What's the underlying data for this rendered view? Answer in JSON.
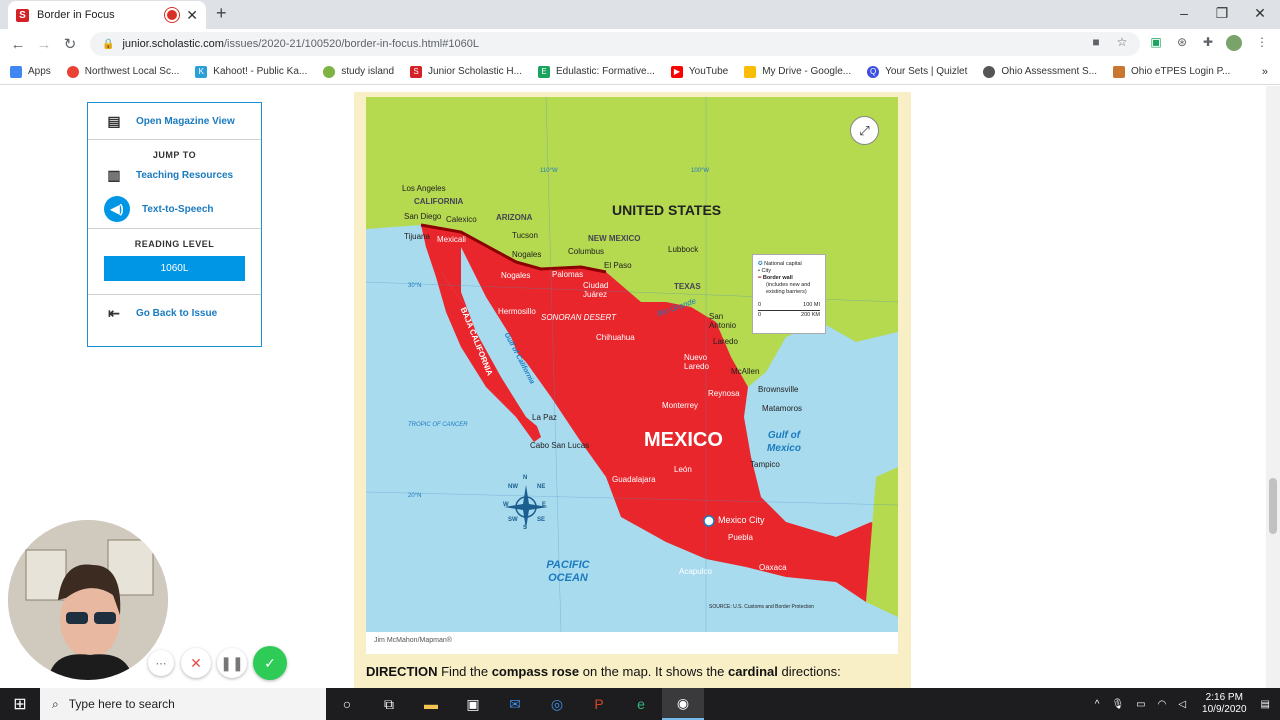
{
  "browser": {
    "tab_title": "Border in Focus",
    "favicon_letter": "S",
    "new_tab": "+",
    "url_host": "junior.scholastic.com",
    "url_path": "/issues/2020-21/100520/border-in-focus.html#1060L"
  },
  "bookmarks": [
    {
      "label": "Apps",
      "color": "#4285f4"
    },
    {
      "label": "Northwest Local Sc...",
      "color": "#e94235"
    },
    {
      "label": "Kahoot! - Public Ka...",
      "color": "#2a9fd8"
    },
    {
      "label": "study island",
      "color": "#7cb342"
    },
    {
      "label": "Junior Scholastic H...",
      "color": "#d42127"
    },
    {
      "label": "Edulastic: Formative...",
      "color": "#1aa260"
    },
    {
      "label": "YouTube",
      "color": "#ff0000"
    },
    {
      "label": "My Drive - Google...",
      "color": "#fbbc04"
    },
    {
      "label": "Your Sets | Quizlet",
      "color": "#3c4fe0"
    },
    {
      "label": "Ohio Assessment S...",
      "color": "#555555"
    },
    {
      "label": "Ohio eTPES Login P...",
      "color": "#c9762f"
    }
  ],
  "sidebar": {
    "magazine": "Open Magazine View",
    "jump_to": "JUMP TO",
    "teaching": "Teaching Resources",
    "tts": "Text-to-Speech",
    "reading_level_label": "READING LEVEL",
    "reading_level_value": "1060L",
    "back": "Go Back to Issue"
  },
  "map": {
    "credit": "Jim McMahon/Mapman®",
    "source": "SOURCE: U.S. Customs and Border Protection",
    "legend": {
      "capital": "National capital",
      "city": "City",
      "wall": "Border wall",
      "wall_note": "(includes new and existing barriers)",
      "scale_mi": "100 MI",
      "scale_km": "200 KM",
      "scale_zero": "0"
    },
    "countries": {
      "us": "UNITED STATES",
      "mexico": "MEXICO"
    },
    "seas": {
      "pacific": "PACIFIC OCEAN",
      "gulf": "Gulf of Mexico",
      "gulf_cal": "Gulf of California"
    },
    "regions": {
      "california": "CALIFORNIA",
      "arizona": "ARIZONA",
      "new_mexico": "NEW MEXICO",
      "texas": "TEXAS",
      "baja": "BAJA CALIFORNIA",
      "sonoran": "SONORAN DESERT",
      "rio": "Rio Grande",
      "tropic": "TROPIC OF CANCER"
    },
    "grid": {
      "lon110": "110°W",
      "lon100": "100°W",
      "lat30": "30°N",
      "lat20": "20°N"
    },
    "compass": {
      "n": "N",
      "ne": "NE",
      "e": "E",
      "se": "SE",
      "s": "S",
      "sw": "SW",
      "w": "W",
      "nw": "NW"
    },
    "cities": {
      "los_angeles": "Los Angeles",
      "san_diego": "San Diego",
      "calexico": "Calexico",
      "tijuana": "Tijuana",
      "mexicali": "Mexicali",
      "tucson": "Tucson",
      "nogales_us": "Nogales",
      "nogales_mx": "Nogales",
      "columbus": "Columbus",
      "el_paso": "El Paso",
      "palomas": "Palomas",
      "ciudad_juarez": "Ciudad Juárez",
      "lubbock": "Lubbock",
      "hermosillo": "Hermosillo",
      "chihuahua": "Chihuahua",
      "san_antonio": "San Antonio",
      "laredo": "Laredo",
      "nuevo_laredo": "Nuevo Laredo",
      "mcallen": "McAllen",
      "reynosa": "Reynosa",
      "brownsville": "Brownsville",
      "matamoros": "Matamoros",
      "monterrey": "Monterrey",
      "la_paz": "La Paz",
      "cabo": "Cabo San Lucas",
      "tampico": "Tampico",
      "leon": "León",
      "guadalajara": "Guadalajara",
      "mexico_city": "Mexico City",
      "puebla": "Puebla",
      "acapulco": "Acapulco",
      "oaxaca": "Oaxaca"
    }
  },
  "direction": {
    "lead": "DIRECTION",
    "t1": " Find the ",
    "b1": "compass rose",
    "t2": " on the map. It shows the ",
    "b2": "cardinal",
    "t3": " directions:"
  },
  "taskbar": {
    "search_placeholder": "Type here to search",
    "time": "2:16 PM",
    "date": "10/9/2020"
  },
  "colors": {
    "accent": "#0096e6",
    "mexico": "#e8262c",
    "us": "#b5d94f",
    "ocean": "#a9dbef"
  }
}
